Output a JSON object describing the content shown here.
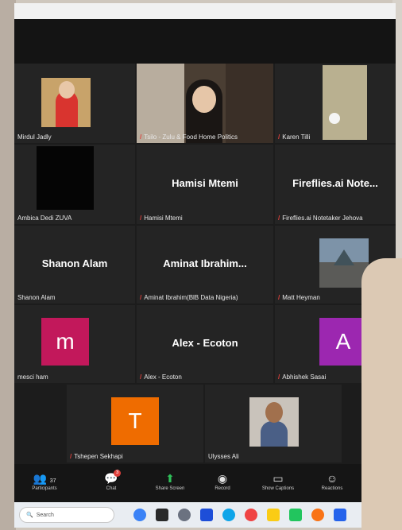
{
  "tiles": [
    {
      "name": "Mirdul Jadly",
      "center": ""
    },
    {
      "name": "Tsilo - Zulu & Food Home Politics",
      "center": ""
    },
    {
      "name": "Karen Tilli",
      "center": ""
    },
    {
      "name": "Ambica Dedi ZUVA",
      "center": ""
    },
    {
      "name": "Hamisi Mtemi",
      "center": "Hamisi Mtemi"
    },
    {
      "name": "Fireflies.ai Notetaker Jehova",
      "center": "Fireflies.ai  Note..."
    },
    {
      "name": "Shanon Alam",
      "center": "Shanon Alam"
    },
    {
      "name": "Aminat Ibrahim(BlB Data Nigeria)",
      "center": "Aminat  Ibrahim..."
    },
    {
      "name": "Matt Heyman",
      "center": ""
    },
    {
      "name": "mesci ham",
      "center": ""
    },
    {
      "name": "Alex - Ecoton",
      "center": "Alex - Ecoton"
    },
    {
      "name": "Abhishek Sasai",
      "center": ""
    },
    {
      "name": "Tshepen Sekhapi",
      "center": ""
    },
    {
      "name": "Ulysses Ali",
      "center": ""
    }
  ],
  "avatars": {
    "m": {
      "letter": "m",
      "color": "#c2185b"
    },
    "A": {
      "letter": "A",
      "color": "#9c27b0"
    },
    "T": {
      "letter": "T",
      "color": "#ef6c00"
    }
  },
  "toolbar": {
    "participants_label": "Participants",
    "participants_count": "37",
    "chat_label": "Chat",
    "chat_badge": "3",
    "share_label": "Share Screen",
    "record_label": "Record",
    "captions_label": "Show Captions",
    "reactions_label": "Reactions"
  },
  "taskbar": {
    "search_placeholder": "Search"
  },
  "colors": {
    "tile_bg": "#242424",
    "mic_muted": "#e0413c",
    "share_green": "#2fc05a"
  }
}
